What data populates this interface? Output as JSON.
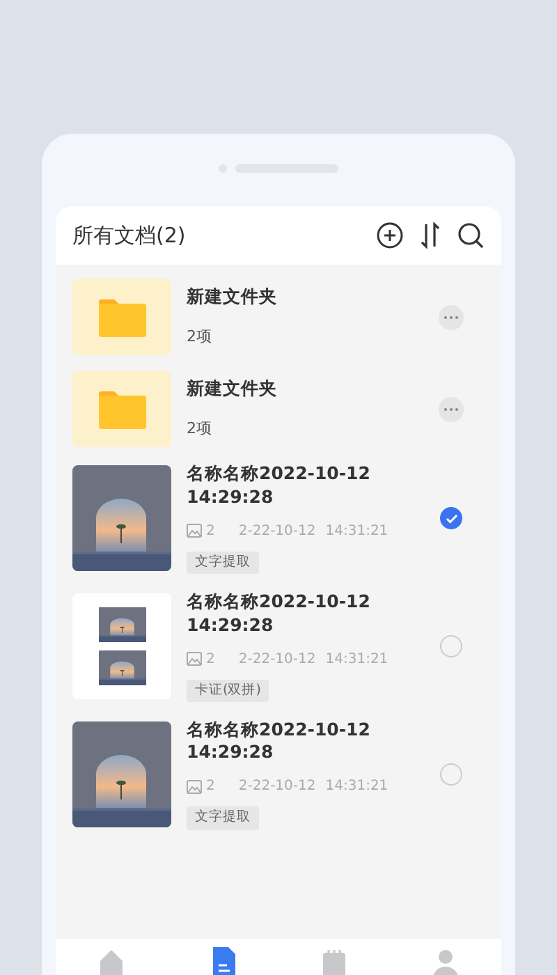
{
  "header": {
    "title": "所有文档(2)"
  },
  "items": [
    {
      "kind": "folder",
      "name": "新建文件夹",
      "count": "2项"
    },
    {
      "kind": "folder",
      "name": "新建文件夹",
      "count": "2项"
    },
    {
      "kind": "document",
      "name": "名称名称2022-10-12 14:29:28",
      "pages": "2",
      "date": "2-22-10-12",
      "time": "14:31:21",
      "tag": "文字提取",
      "selected": true
    },
    {
      "kind": "pair",
      "name": "名称名称2022-10-12 14:29:28",
      "pages": "2",
      "date": "2-22-10-12",
      "time": "14:31:21",
      "tag": "卡证(双拼)",
      "selected": false
    },
    {
      "kind": "document",
      "name": "名称名称2022-10-12 14:29:28",
      "pages": "2",
      "date": "2-22-10-12",
      "time": "14:31:21",
      "tag": "文字提取",
      "selected": false
    }
  ],
  "tabbar": [
    {
      "selected": false
    },
    {
      "selected": true
    },
    {
      "selected": false
    },
    {
      "selected": false
    }
  ]
}
